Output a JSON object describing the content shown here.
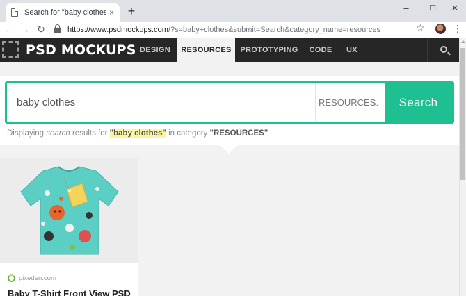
{
  "browser": {
    "tab_title": "Search for \"baby clothes\" - PSD M",
    "tab_close": "×",
    "new_tab": "+",
    "window_controls": {
      "minimize": "–",
      "maximize": "☐",
      "close": "✕"
    },
    "url_host": "https://www.psdmockups.com",
    "url_rest": "/?s=baby+clothes&submit=Search&category_name=resources"
  },
  "site": {
    "logo_text": "PSD MOCKUPS",
    "nav": [
      {
        "label": "DESIGN",
        "active": false
      },
      {
        "label": "RESOURCES",
        "active": true
      },
      {
        "label": "PROTOTYPING",
        "active": false
      },
      {
        "label": "CODE",
        "active": false
      },
      {
        "label": "UX",
        "active": false
      }
    ]
  },
  "search": {
    "query": "baby clothes",
    "category": "RESOURCES",
    "button_label": "Search",
    "results_prefix": "Displaying ",
    "results_em": "search",
    "results_mid": " results for ",
    "results_query": "\"baby clothes\"",
    "results_in": " in category ",
    "results_category": "\"RESOURCES\""
  },
  "results": [
    {
      "source": "pixeden.com",
      "title": "Baby T-Shirt Front View PSD"
    }
  ],
  "colors": {
    "accent": "#1ebf91",
    "nav_bg": "#262626",
    "shirt": "#5ccfc4"
  }
}
